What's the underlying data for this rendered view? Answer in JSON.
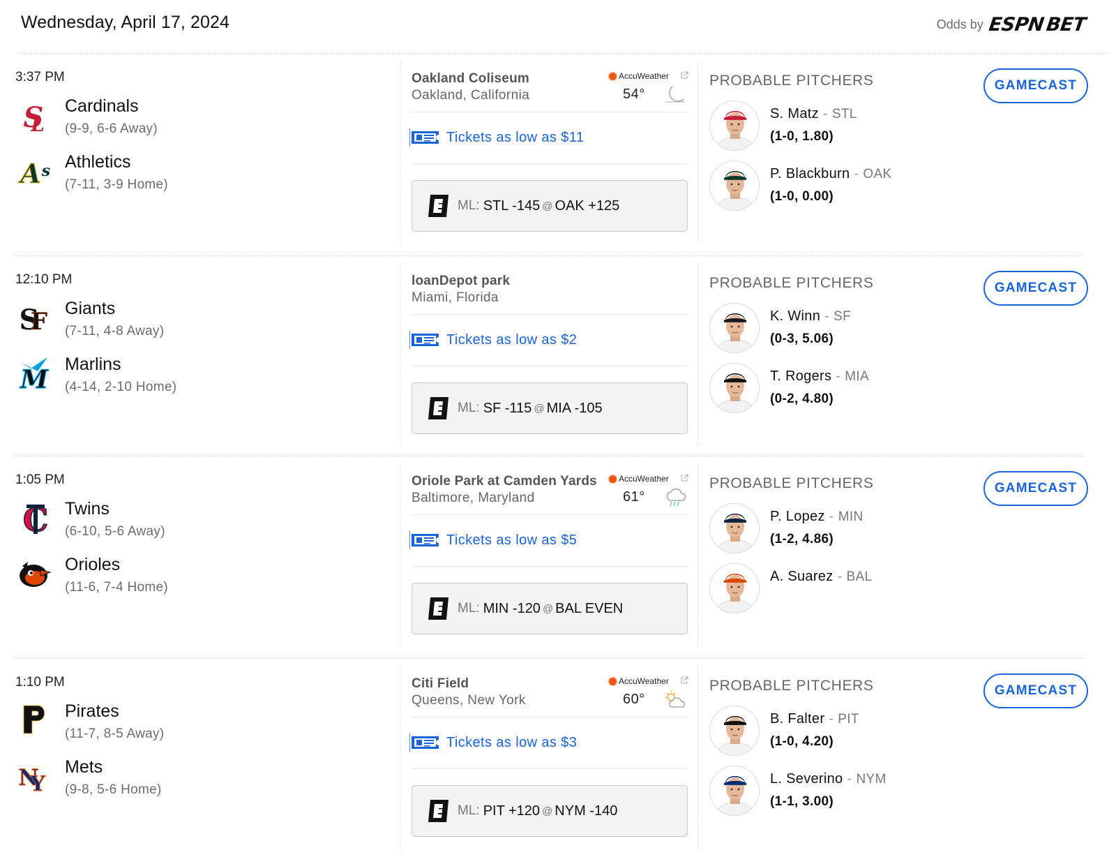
{
  "header": {
    "date": "Wednesday, April 17, 2024",
    "odds_by": "Odds by",
    "brand_part1": "ESPN",
    "brand_part2": "BET"
  },
  "labels": {
    "probable_pitchers": "PROBABLE PITCHERS",
    "gamecast": "GAMECAST",
    "ml": "ML:",
    "at": "@",
    "accuweather": "AccuWeather"
  },
  "games": [
    {
      "time": "3:37 PM",
      "away": {
        "name": "Cardinals",
        "record": "(9-9, 6-6 Away)",
        "logo_icon": "cardinals-logo-icon",
        "color": "#c41e3a"
      },
      "home": {
        "name": "Athletics",
        "record": "(7-11, 3-9 Home)",
        "logo_icon": "athletics-logo-icon",
        "color": "#003831"
      },
      "venue": {
        "name": "Oakland Coliseum",
        "city": "Oakland, California"
      },
      "weather": {
        "temp": "54°",
        "icon": "moon-icon"
      },
      "tickets": "Tickets as low as $11",
      "odds": {
        "away": "STL -145",
        "home": "OAK +125"
      },
      "pitchers": [
        {
          "name": "S. Matz",
          "team": "STL",
          "stats": "(1-0, 1.80)",
          "cap_color": "#c41e3a"
        },
        {
          "name": "P. Blackburn",
          "team": "OAK",
          "stats": "(1-0, 0.00)",
          "cap_color": "#0e3b2e"
        }
      ]
    },
    {
      "time": "12:10 PM",
      "away": {
        "name": "Giants",
        "record": "(7-11, 4-8 Away)",
        "logo_icon": "giants-logo-icon",
        "color": "#111111"
      },
      "home": {
        "name": "Marlins",
        "record": "(4-14, 2-10 Home)",
        "logo_icon": "marlins-logo-icon",
        "color": "#0a0a0a"
      },
      "venue": {
        "name": "loanDepot park",
        "city": "Miami, Florida"
      },
      "weather": null,
      "tickets": "Tickets as low as $2",
      "odds": {
        "away": "SF -115",
        "home": "MIA -105"
      },
      "pitchers": [
        {
          "name": "K. Winn",
          "team": "SF",
          "stats": "(0-3, 5.06)",
          "cap_color": "#1a1a1a"
        },
        {
          "name": "T. Rogers",
          "team": "MIA",
          "stats": "(0-2, 4.80)",
          "cap_color": "#111111"
        }
      ]
    },
    {
      "time": "1:05 PM",
      "away": {
        "name": "Twins",
        "record": "(6-10, 5-6 Away)",
        "logo_icon": "twins-logo-icon",
        "color": "#d31145"
      },
      "home": {
        "name": "Orioles",
        "record": "(11-6, 7-4 Home)",
        "logo_icon": "orioles-logo-icon",
        "color": "#df4601"
      },
      "venue": {
        "name": "Oriole Park at Camden Yards",
        "city": "Baltimore, Maryland"
      },
      "weather": {
        "temp": "61°",
        "icon": "rain-cloud-icon"
      },
      "tickets": "Tickets as low as $5",
      "odds": {
        "away": "MIN -120",
        "home": "BAL EVEN"
      },
      "pitchers": [
        {
          "name": "P. Lopez",
          "team": "MIN",
          "stats": "(1-2, 4.86)",
          "cap_color": "#0c2340"
        },
        {
          "name": "A. Suarez",
          "team": "BAL",
          "stats": "",
          "cap_color": "#df4601"
        }
      ]
    },
    {
      "time": "1:10 PM",
      "away": {
        "name": "Pirates",
        "record": "(11-7, 8-5 Away)",
        "logo_icon": "pirates-logo-icon",
        "color": "#111111"
      },
      "home": {
        "name": "Mets",
        "record": "(9-8, 5-6 Home)",
        "logo_icon": "mets-logo-icon",
        "color": "#002d72"
      },
      "venue": {
        "name": "Citi Field",
        "city": "Queens, New York"
      },
      "weather": {
        "temp": "60°",
        "icon": "partly-cloudy-icon"
      },
      "tickets": "Tickets as low as $3",
      "odds": {
        "away": "PIT +120",
        "home": "NYM -140"
      },
      "pitchers": [
        {
          "name": "B. Falter",
          "team": "PIT",
          "stats": "(1-0, 4.20)",
          "cap_color": "#111111"
        },
        {
          "name": "L. Severino",
          "team": "NYM",
          "stats": "(1-1, 3.00)",
          "cap_color": "#002d72"
        }
      ]
    }
  ]
}
